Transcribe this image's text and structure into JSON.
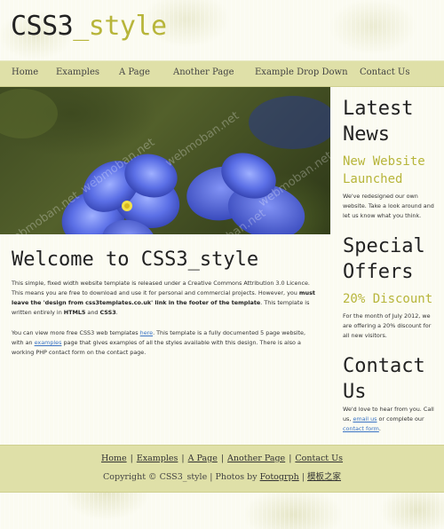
{
  "site": {
    "logo_part1": "CSS3",
    "logo_part2": "_style"
  },
  "menu": {
    "items": [
      "Home",
      "Examples",
      "A Page",
      "Another Page",
      "Example Drop Down",
      "Contact Us"
    ]
  },
  "hero": {
    "watermark": "webmoban.net"
  },
  "content": {
    "title": "Welcome to CSS3_style",
    "p1_a": "This simple, fixed width website template is released under a Creative Commons Attribution 3.0 Licence. This means you are free to download and use it for personal and commercial projects. However, you ",
    "p1_bold": "must leave the 'design from css3templates.co.uk' link in the footer of the template",
    "p1_b": ". This template is written entirely in ",
    "p1_html5": "HTML5",
    "p1_and": " and ",
    "p1_css3": "CSS3",
    "p1_end": ".",
    "p2_a": "You can view more free CSS3 web templates ",
    "p2_link": "here",
    "p2_b": ". This template is a fully documented 5 page website, with an ",
    "p2_link2": "examples",
    "p2_c": " page that gives examples of all the styles available with this design. There is also a working PHP contact form on the contact page."
  },
  "sidebar": {
    "latest_title": "Latest News",
    "latest_sub": "New Website Launched",
    "latest_text": "We've redesigned our own website. Take a look around and let us know what you think.",
    "special_title": "Special Offers",
    "special_sub": "20% Discount",
    "special_text": "For the month of July 2012, we are offering a 20% discount for all new visitors.",
    "contact_title": "Contact Us",
    "contact_text_a": "We'd love to hear from you. Call us, ",
    "contact_email": "email us",
    "contact_text_b": " or complete our ",
    "contact_form": "contact form",
    "contact_text_c": "."
  },
  "footer": {
    "links": [
      "Home",
      "Examples",
      "A Page",
      "Another Page",
      "Contact Us"
    ],
    "copyright": "Copyright © CSS3_style | Photos by ",
    "photos_link": "Fotogrph",
    "sep": " | ",
    "cn_link": "模板之家"
  },
  "colors": {
    "accent": "#b7b53a",
    "bar": "#dfe0a8",
    "link": "#3a73c4"
  }
}
